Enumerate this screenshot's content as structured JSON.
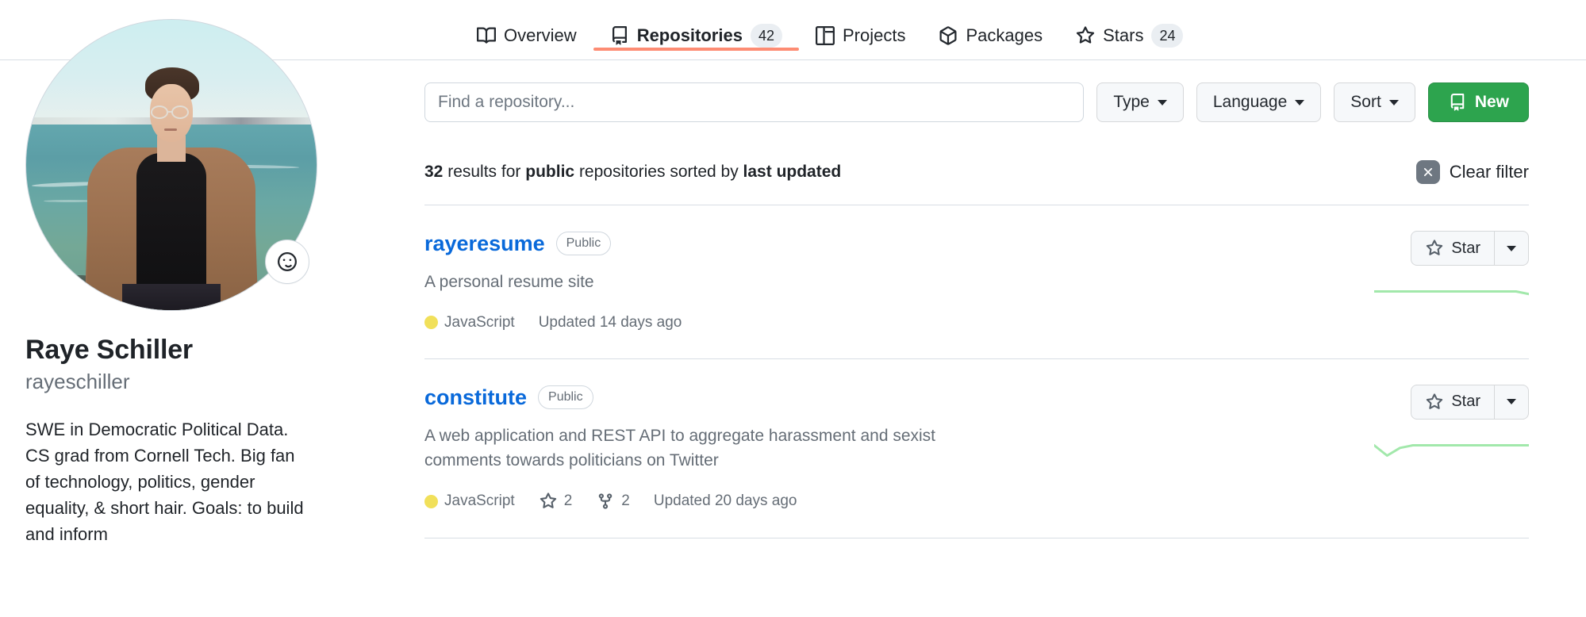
{
  "tabs": [
    {
      "label": "Overview",
      "icon": "book-icon",
      "count": null,
      "active": false
    },
    {
      "label": "Repositories",
      "icon": "repo-icon",
      "count": "42",
      "active": true
    },
    {
      "label": "Projects",
      "icon": "project-icon",
      "count": null,
      "active": false
    },
    {
      "label": "Packages",
      "icon": "package-icon",
      "count": null,
      "active": false
    },
    {
      "label": "Stars",
      "icon": "star-icon",
      "count": "24",
      "active": false
    }
  ],
  "profile": {
    "name": "Raye Schiller",
    "handle": "rayeschiller",
    "bio": "SWE in Democratic Political Data. CS grad from Cornell Tech. Big fan of technology, politics, gender equality, & short hair. Goals: to build and inform",
    "status_icon": "smiley-icon",
    "avatar_alt": "profile-photo"
  },
  "search": {
    "placeholder": "Find a repository...",
    "value": ""
  },
  "filters": [
    {
      "label": "Type"
    },
    {
      "label": "Language"
    },
    {
      "label": "Sort"
    }
  ],
  "new_button": {
    "label": "New",
    "icon": "repo-icon",
    "color": "#2da44e"
  },
  "results": {
    "count": "32",
    "pre": "results for",
    "visibility": "public",
    "mid": "repositories sorted by",
    "sort": "last updated",
    "clear_label": "Clear filter",
    "clear_icon": "close-circle-icon"
  },
  "star_action": {
    "label": "Star",
    "icon": "star-icon",
    "menu_icon": "chevron-down-icon"
  },
  "colors": {
    "accent_blue": "#0969da",
    "active_tab_underline": "#fd8c73",
    "javascript": "#f1e05a",
    "sparkline_green": "#a2e8ab",
    "green_button": "#2da44e"
  },
  "repositories": [
    {
      "name": "rayeresume",
      "visibility": "Public",
      "description": "A personal resume site",
      "language": "JavaScript",
      "language_color": "#f1e05a",
      "stars": null,
      "forks": null,
      "updated": "Updated 14 days ago",
      "sparkline": [
        6,
        6,
        6,
        6,
        6,
        6,
        6,
        6,
        6,
        6,
        6,
        6,
        5
      ]
    },
    {
      "name": "constitute",
      "visibility": "Public",
      "description": "A web application and REST API to aggregate harassment and sexist comments towards politicians on Twitter",
      "language": "JavaScript",
      "language_color": "#f1e05a",
      "stars": "2",
      "forks": "2",
      "updated": "Updated 20 days ago",
      "sparkline": [
        6,
        2,
        5,
        6,
        6,
        6,
        6,
        6,
        6,
        6,
        6,
        6,
        6
      ]
    }
  ]
}
